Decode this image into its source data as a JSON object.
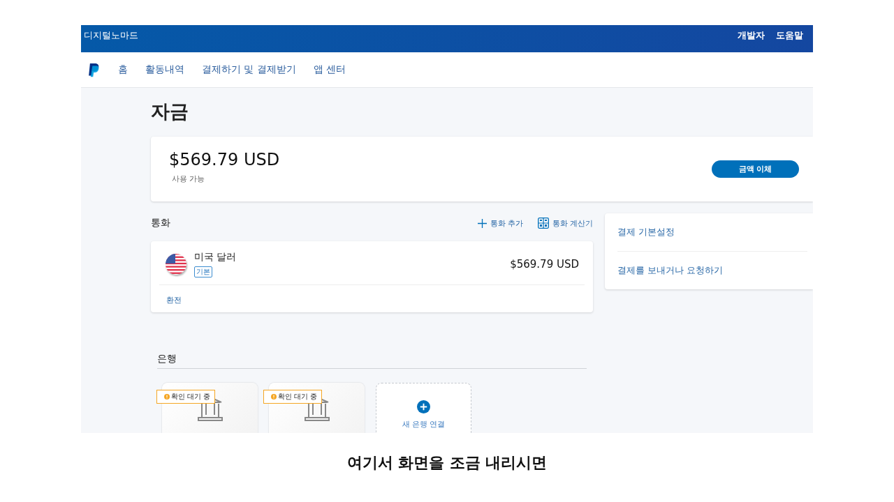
{
  "top_bar": {
    "account": "디지털노마드",
    "links": [
      "개발자",
      "도움말"
    ]
  },
  "nav": {
    "items": [
      {
        "label": "홈",
        "selected": false
      },
      {
        "label": "활동내역",
        "selected": false
      },
      {
        "label": "결제하기 및 결제받기",
        "selected": false
      },
      {
        "label": "앱 센터",
        "selected": false
      }
    ]
  },
  "page_title": "자금",
  "balance": {
    "amount": "$569.79 USD",
    "caption": "사용 가능",
    "button": "금액 이체"
  },
  "currencies": {
    "heading": "통화",
    "actions": [
      {
        "kind": "add",
        "label": "통화 추가"
      },
      {
        "kind": "calculator",
        "label": "통화 계산기"
      }
    ],
    "items": [
      {
        "name": "미국 달러",
        "badge": "기본",
        "amount": "$569.79 USD",
        "link": "환전"
      }
    ]
  },
  "side_links": [
    "결제 기본설정",
    "결제를 보내거나 요청하기"
  ],
  "banks": {
    "heading": "은행",
    "cards": [
      {
        "kind": "bank",
        "status": "확인 대기 중"
      },
      {
        "kind": "bank",
        "status": "확인 대기 중"
      },
      {
        "kind": "add",
        "label": "새 은행 연결"
      }
    ]
  },
  "caption": "여기서 화면을 조금 내리시면"
}
